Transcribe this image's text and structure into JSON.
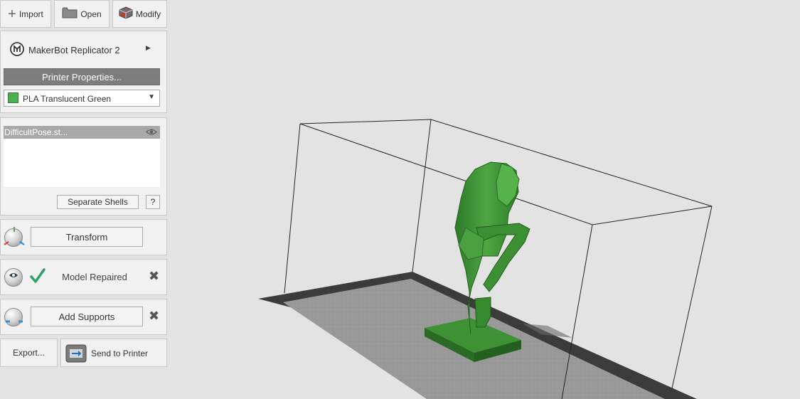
{
  "toolbar": {
    "import_label": "Import",
    "open_label": "Open",
    "modify_label": "Modify"
  },
  "printer": {
    "name": "MakerBot Replicator 2",
    "properties_label": "Printer Properties...",
    "material": "PLA Translucent Green",
    "material_color": "#4caf50"
  },
  "objects": {
    "items": [
      {
        "name": "DifficultPose.st..."
      }
    ],
    "separate_shells_label": "Separate Shells",
    "help_label": "?"
  },
  "steps": {
    "transform_label": "Transform",
    "repair_status": "Model Repaired",
    "add_supports_label": "Add Supports"
  },
  "footer": {
    "export_label": "Export...",
    "send_label": "Send to Printer"
  },
  "colors": {
    "model_green": "#3d8f34",
    "checkmark": "#2e9e6a"
  }
}
